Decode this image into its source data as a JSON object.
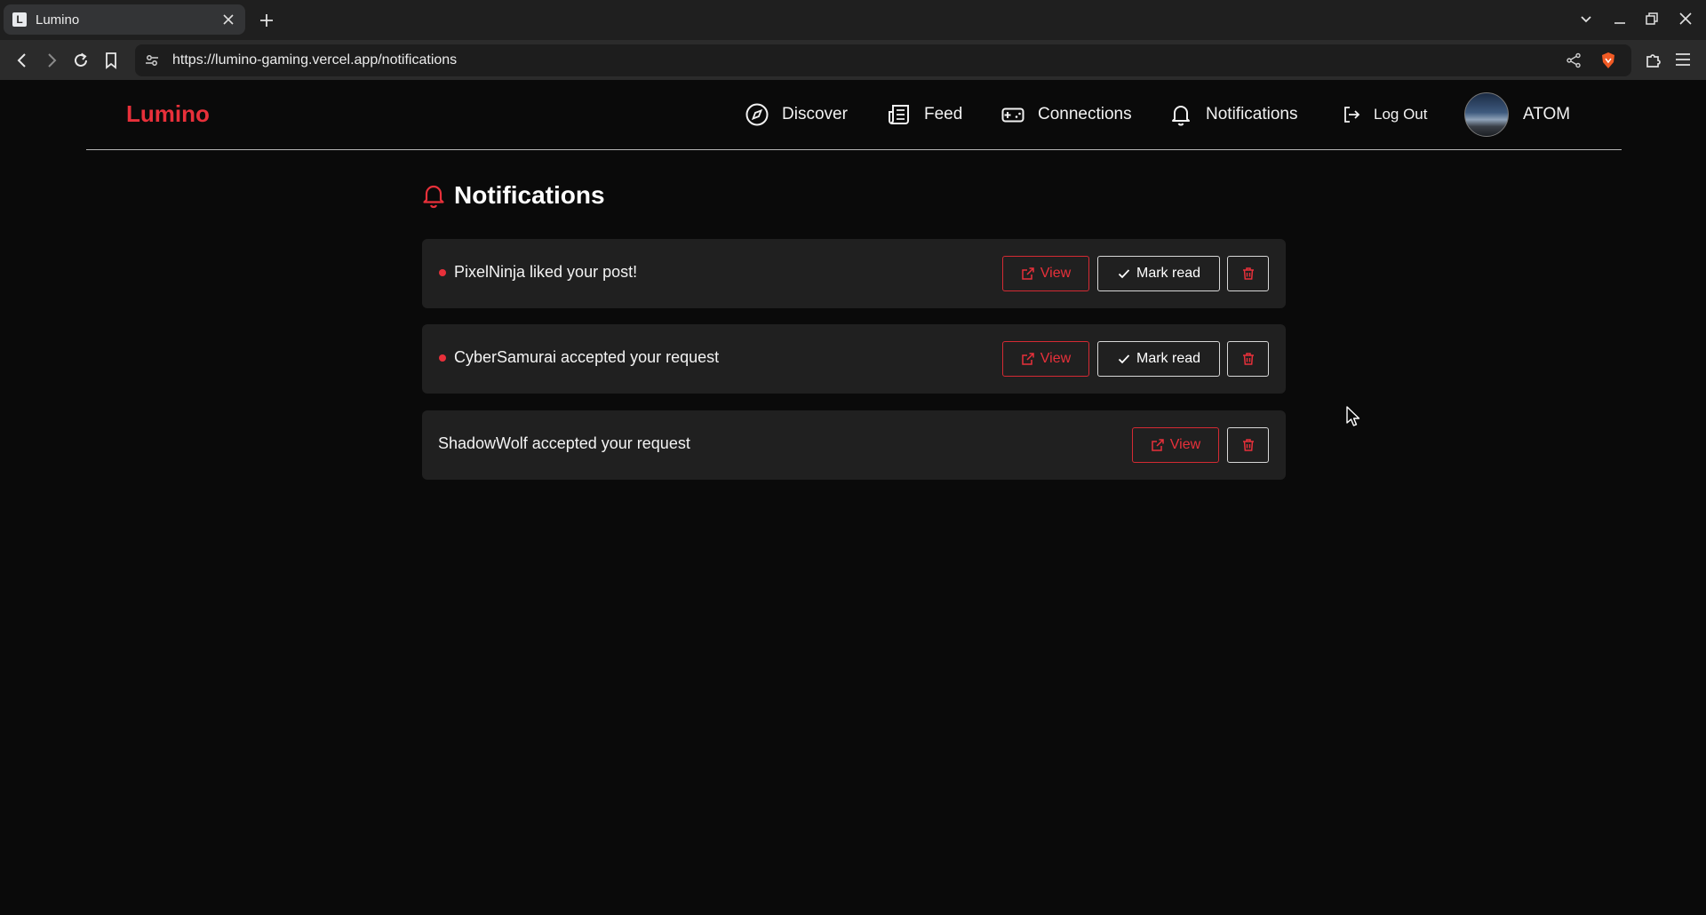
{
  "browser": {
    "tab_title": "Lumino",
    "tab_favicon_letter": "L",
    "url": "https://lumino-gaming.vercel.app/notifications",
    "accent_color": "#e8303a"
  },
  "site": {
    "logo": "Lumino",
    "nav": [
      {
        "label": "Discover",
        "icon": "compass-icon"
      },
      {
        "label": "Feed",
        "icon": "newspaper-icon"
      },
      {
        "label": "Connections",
        "icon": "gamepad-icon"
      },
      {
        "label": "Notifications",
        "icon": "bell-icon"
      },
      {
        "label": "Log Out",
        "icon": "logout-icon"
      }
    ],
    "user": {
      "name": "ATOM"
    }
  },
  "page": {
    "title": "Notifications",
    "title_icon": "bell-icon"
  },
  "notifications": [
    {
      "text": "PixelNinja liked your post!",
      "unread": true,
      "view_label": "View",
      "mark_read_label": "Mark read"
    },
    {
      "text": "CyberSamurai accepted your request",
      "unread": true,
      "view_label": "View",
      "mark_read_label": "Mark read"
    },
    {
      "text": "ShadowWolf accepted your request",
      "unread": false,
      "view_label": "View"
    }
  ]
}
